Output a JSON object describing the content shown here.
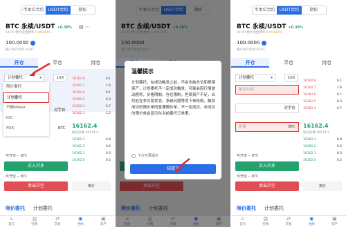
{
  "top_tabs": [
    "币本位合约",
    "USDT合约",
    "期权"
  ],
  "pair": {
    "name": "BTC 永续/USDT",
    "change": "+0.38%"
  },
  "funding": {
    "label": "14:00 预计资金费率",
    "value": "0.00142%"
  },
  "balance": {
    "value": "100.0000",
    "sub": "账户资产折合 USDT"
  },
  "order_tabs": [
    "开仓",
    "平仓",
    "持仓"
  ],
  "order_type": "计划委托",
  "leverage": "10X",
  "dropdown": [
    "限价委托",
    "计划委托",
    "只做Maker",
    "IOC",
    "FOK"
  ],
  "order_book": {
    "asks": [
      [
        "16162.8",
        "0.1"
      ],
      [
        "16162.7",
        "1.6"
      ],
      [
        "16162.6",
        "0.1"
      ],
      [
        "16162.5",
        "0.3"
      ],
      [
        "16162.4",
        "0.7"
      ],
      [
        "16162.3",
        "1.2"
      ]
    ],
    "bids": [
      [
        "16162.3",
        "0.8"
      ],
      [
        "16162.2",
        "0.6"
      ],
      [
        "16162.1",
        "0.3"
      ],
      [
        "16162.0",
        "0.5"
      ],
      [
        "16161.9",
        "0.9"
      ],
      [
        "16161.8",
        "0.4"
      ]
    ],
    "last_price": "16162.4",
    "mark_price": "标记价格 16174.2"
  },
  "fields": {
    "trigger": "触发价格",
    "price_mode": "对手价",
    "qty": "数量",
    "qty_unit": "BTC"
  },
  "buy": {
    "avail": "可开多 -- BTC",
    "label": "买入开多",
    "side": "平台"
  },
  "sell": {
    "avail": "可开空 -- BTC",
    "label": "卖出开空",
    "side": "离价"
  },
  "bottom_tabs": [
    "限价委托",
    "计划委托"
  ],
  "bottom_nav": [
    "首页",
    "行情",
    "交易",
    "合约",
    "资产"
  ],
  "modal": {
    "title": "温馨提示",
    "body": "计划委托，在成功触发之前，不会冻结仓位和担保资产，计划委托不一定成功触发，可能会因行情波动剧烈，价格限制，仓位限制，担保资产不足，合约处在非交易状态，系统问题等而下单失败，触发成功的限价单同普通限价单，不一定成交，未成交的限价单会显示在当前委托订单里。",
    "check": "下次不再提示",
    "ok": "知道了"
  }
}
